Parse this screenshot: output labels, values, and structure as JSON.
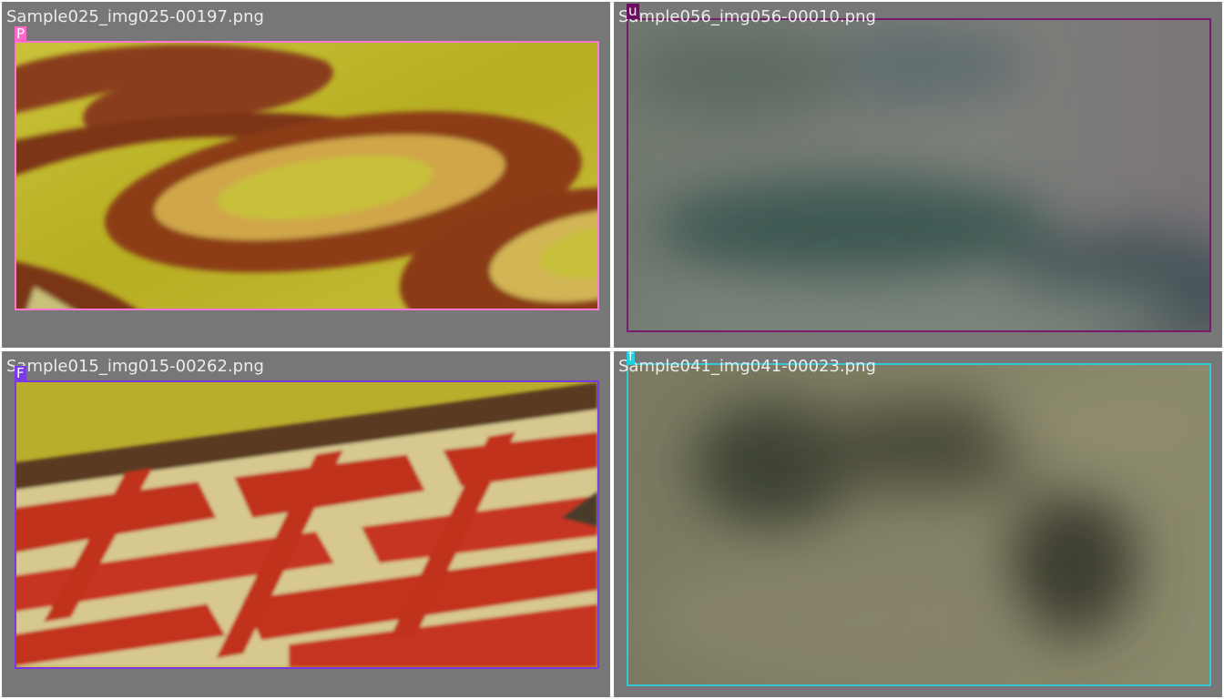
{
  "grid": [
    {
      "filename": "Sample025_img025-00197.png",
      "tag": "P",
      "box_color": "#ff77d0",
      "tag_color": "#ff66cc",
      "scene": "yellow-ochre background with brown curved glyphs"
    },
    {
      "filename": "Sample056_img056-00010.png",
      "tag": "u",
      "box_color": "#7a1a6a",
      "tag_color": "#6a0f5f",
      "scene": "blurry grey-green"
    },
    {
      "filename": "Sample015_img015-00262.png",
      "tag": "F",
      "box_color": "#7c38e0",
      "tag_color": "#7a3ae8",
      "scene": "red glyphs with cream outline on yellow"
    },
    {
      "filename": "Sample041_img041-00023.png",
      "tag": "f",
      "box_color": "#33c8d6",
      "tag_color": "#1fd0e0",
      "scene": "blurry olive-green"
    }
  ],
  "colors": {
    "cell_background": "#777777",
    "divider": "#ffffff",
    "label_text": "#ececec"
  }
}
